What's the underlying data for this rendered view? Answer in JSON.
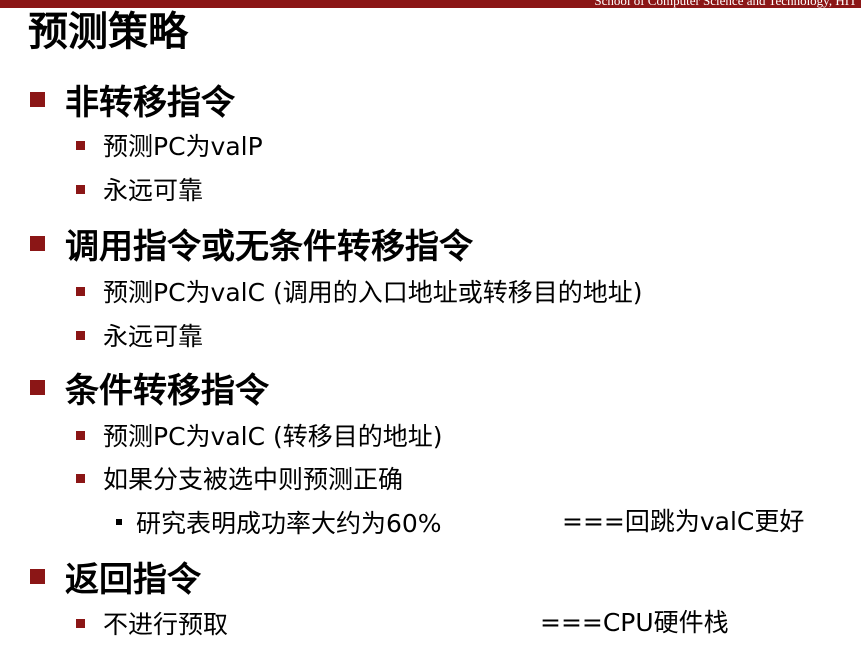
{
  "header": {
    "school": "School of Computer Science and Technology, HIT"
  },
  "colors": {
    "accent": "#8b1616"
  },
  "title": "预测策略",
  "sections": [
    {
      "heading": "非转移指令",
      "items": [
        "预测PC为valP",
        "永远可靠"
      ]
    },
    {
      "heading": "调用指令或无条件转移指令",
      "items": [
        "预测PC为valC (调用的入口地址或转移目的地址)",
        "永远可靠"
      ]
    },
    {
      "heading": "条件转移指令",
      "items": [
        "预测PC为valC (转移目的地址)",
        "如果分支被选中则预测正确"
      ],
      "subitem": "研究表明成功率大约为60%",
      "subitem_note": "===回跳为valC更好"
    },
    {
      "heading": "返回指令",
      "items": [
        "不进行预取"
      ],
      "item_note": "===CPU硬件栈"
    }
  ]
}
